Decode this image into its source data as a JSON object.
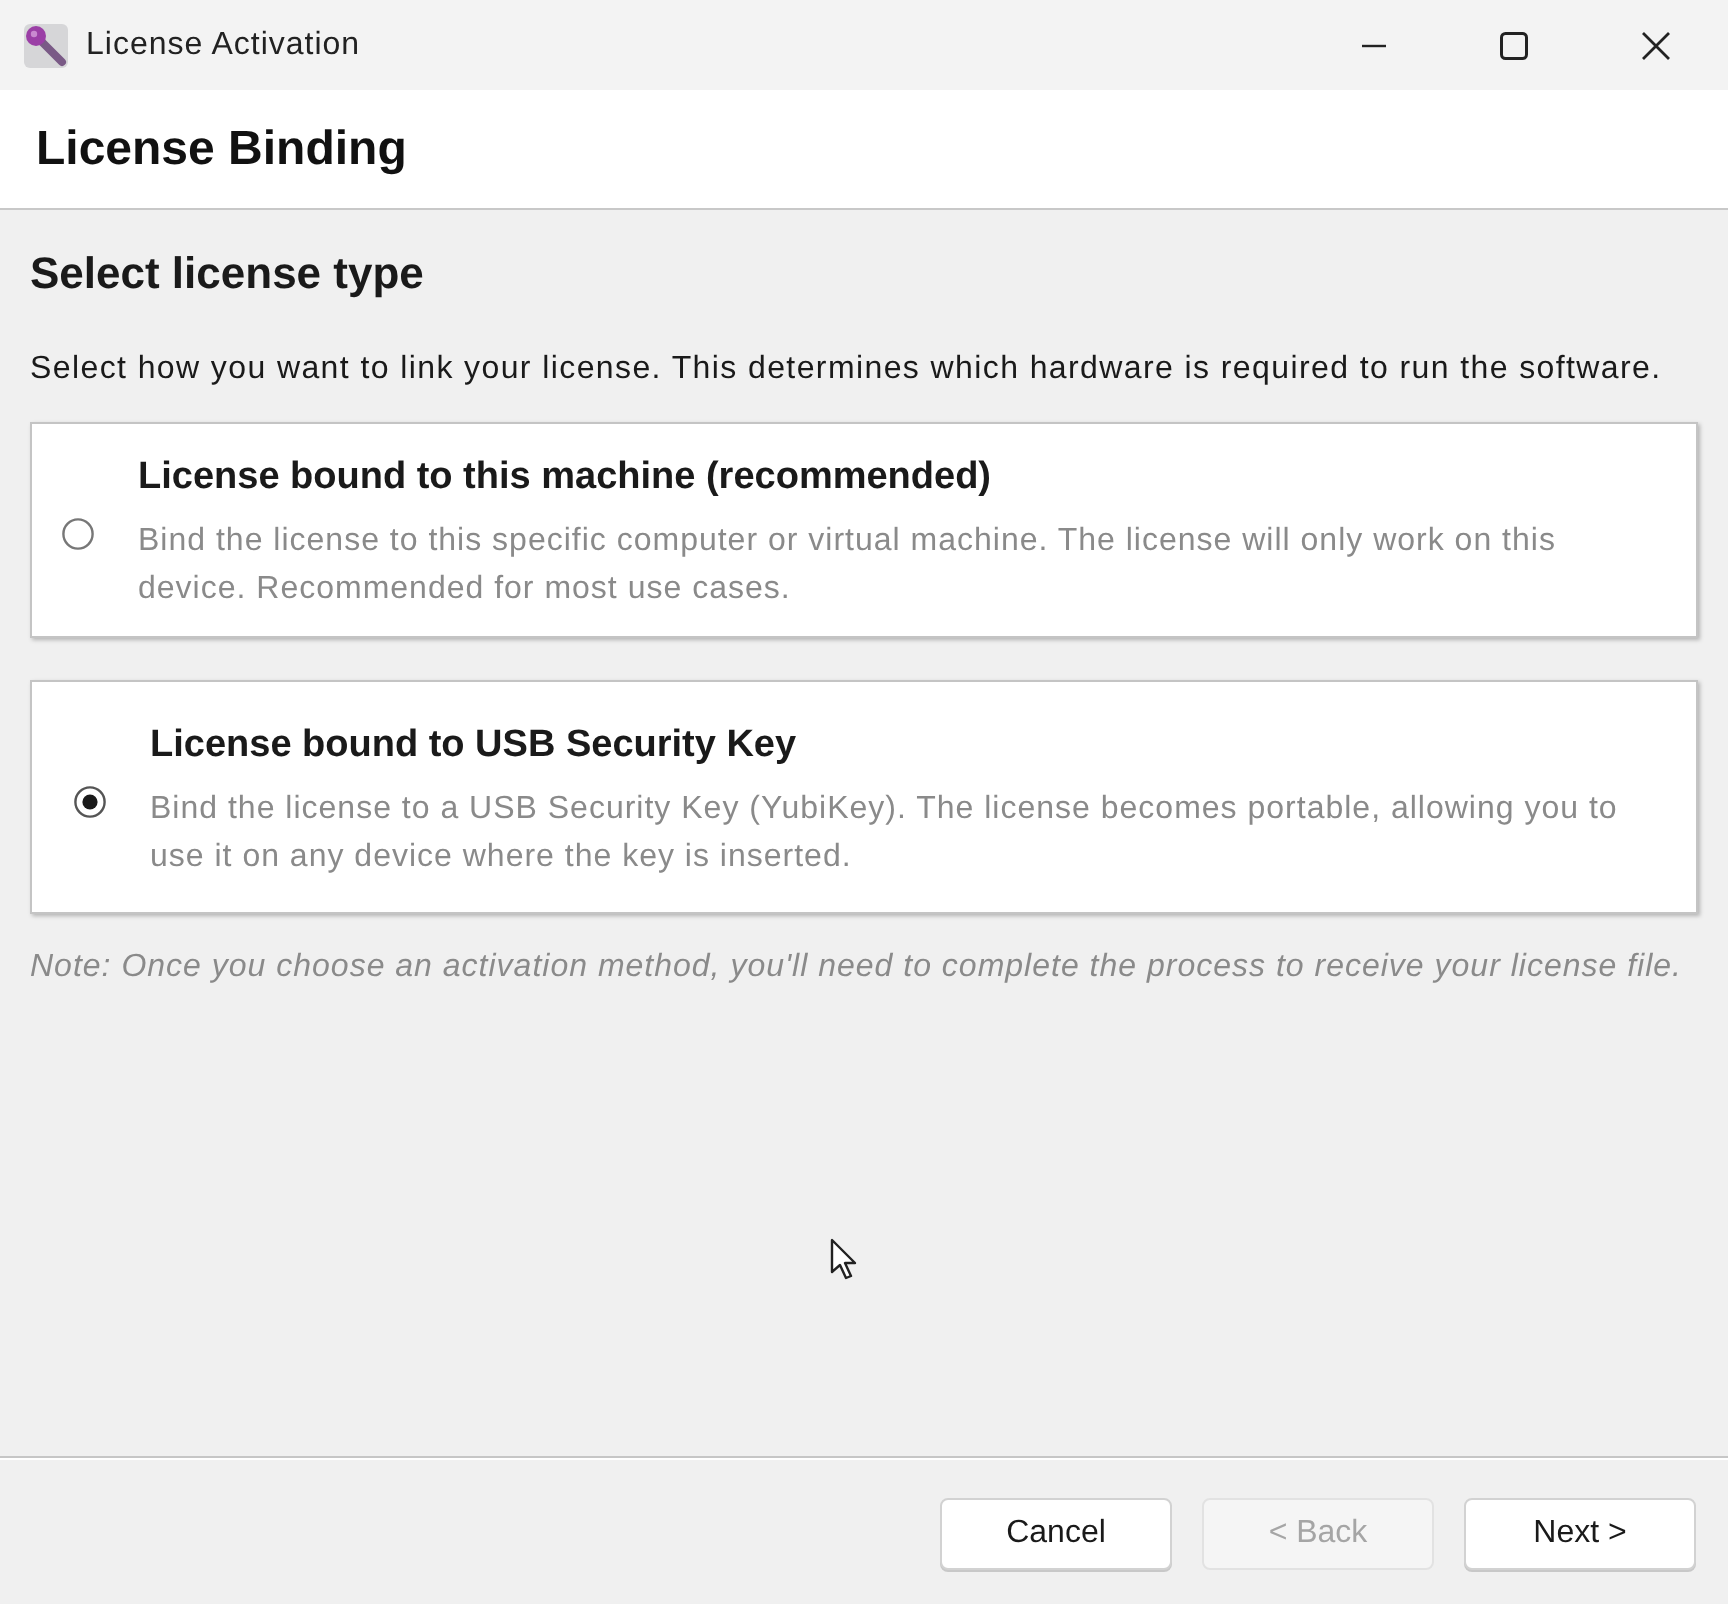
{
  "window": {
    "title": "License Activation"
  },
  "header": {
    "title": "License Binding"
  },
  "section": {
    "heading": "Select license type",
    "description": "Select how you want to link your license. This determines which hardware is required to run the software."
  },
  "options": [
    {
      "title": "License bound to this machine (recommended)",
      "description": "Bind the license to this specific computer or virtual machine. The license will only work on this device. Recommended for most use cases.",
      "selected": false
    },
    {
      "title": "License bound to USB Security Key",
      "description": "Bind the license to a USB Security Key (YubiKey). The license becomes portable, allowing you to use it on any device where the key is inserted.",
      "selected": true
    }
  ],
  "note": "Note: Once you choose an activation method, you'll need to complete the process to receive your license file.",
  "buttons": [
    {
      "label": "Cancel",
      "disabled": false
    },
    {
      "label": "< Back",
      "disabled": true
    },
    {
      "label": "Next >",
      "disabled": false
    }
  ]
}
